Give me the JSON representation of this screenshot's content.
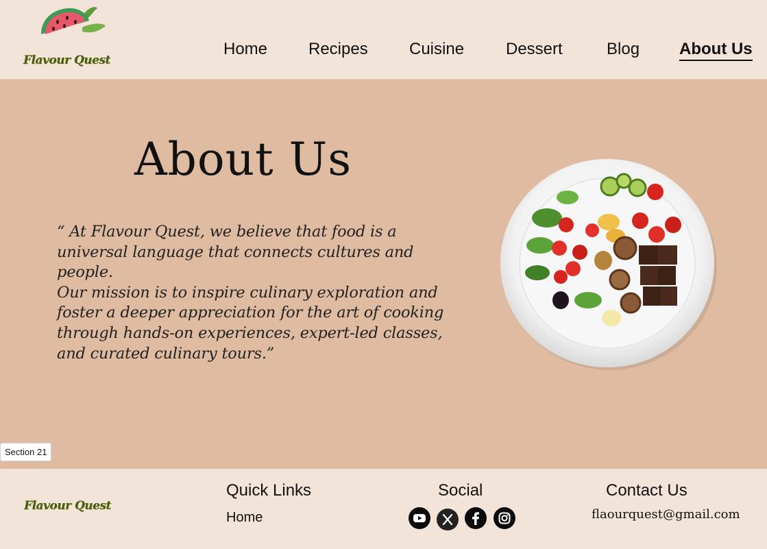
{
  "brand": {
    "name": "Flavour Quest"
  },
  "nav": {
    "items": [
      {
        "label": "Home"
      },
      {
        "label": "Recipes"
      },
      {
        "label": "Cuisine"
      },
      {
        "label": "Dessert"
      },
      {
        "label": "Blog"
      },
      {
        "label": "About Us",
        "active": true
      }
    ]
  },
  "hero": {
    "title": "About Us",
    "quote_line1": "“ At Flavour Quest, we believe that food is a universal language that connects cultures and people.",
    "quote_line2": "Our mission is to inspire culinary exploration and foster a deeper appreciation for the art of cooking through hands-on experiences, expert-led classes, and curated culinary tours.”"
  },
  "section_label": "Section 21",
  "footer": {
    "brand": "Flavour Quest",
    "quick_links": {
      "heading": "Quick Links",
      "items": [
        "Home"
      ]
    },
    "social": {
      "heading": "Social",
      "icons": [
        "youtube-icon",
        "x-icon",
        "facebook-icon",
        "instagram-icon"
      ]
    },
    "contact": {
      "heading": "Contact Us",
      "email": "flaourquest@gmail.com"
    }
  },
  "colors": {
    "header_bg": "#f3e4d9",
    "hero_bg": "#dfbca1",
    "logo_text": "#4a5a10"
  }
}
